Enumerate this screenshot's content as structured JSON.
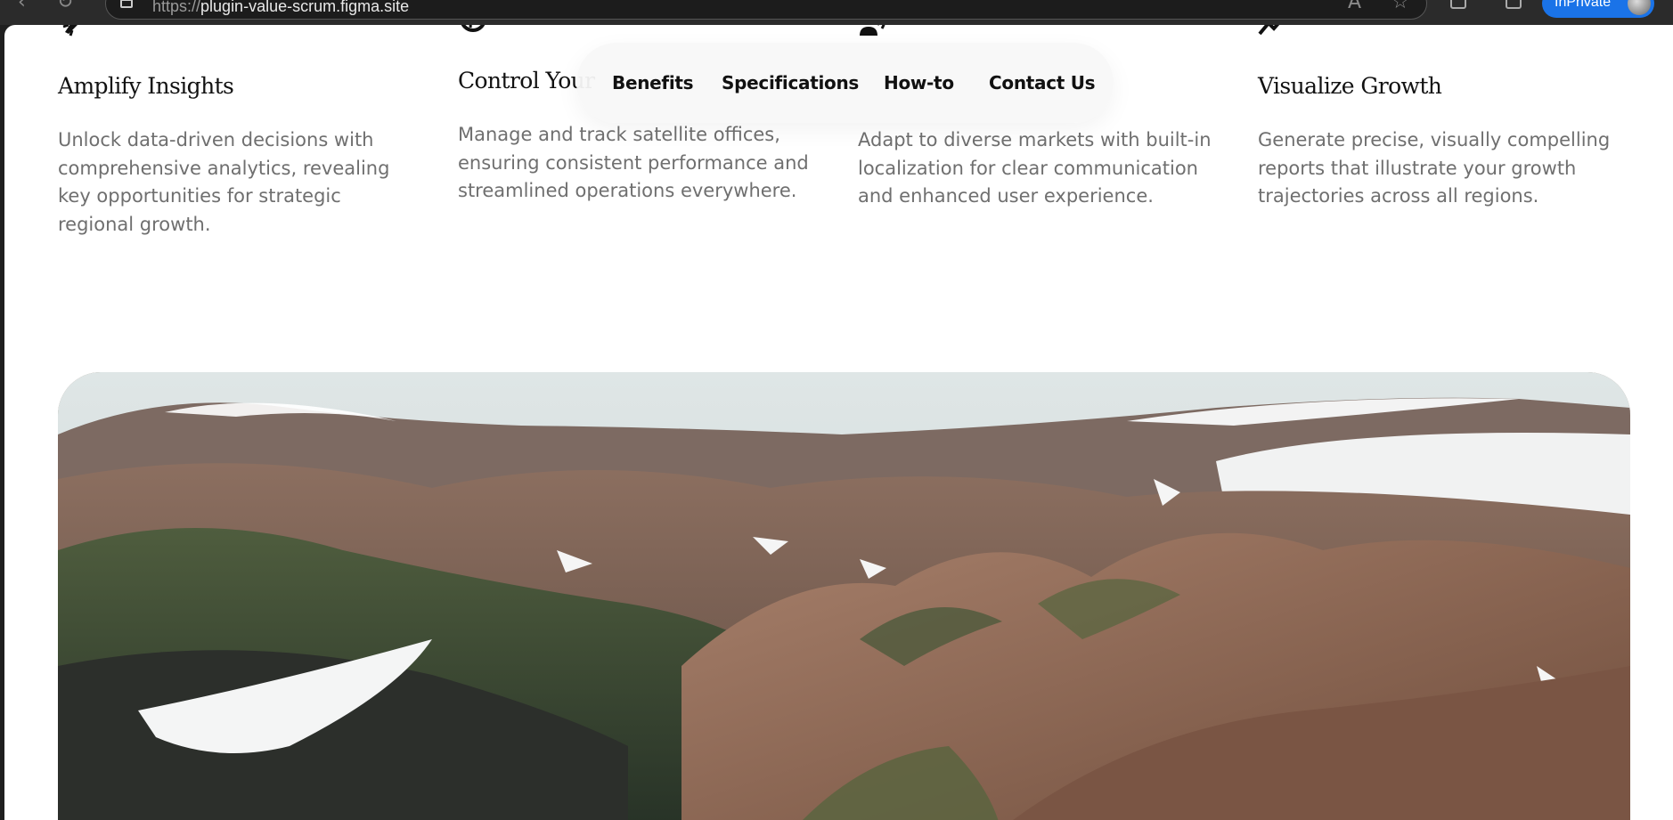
{
  "browser": {
    "url_prefix": "https://",
    "url_host": "plugin-value-scrum.figma.site",
    "profile_label": "InPrivate"
  },
  "nav": {
    "items": [
      "Benefits",
      "Specifications",
      "How-to",
      "Contact Us"
    ]
  },
  "features": [
    {
      "icon": "rocket-icon",
      "title": "Amplify Insights",
      "description": "Unlock data-driven decisions with comprehensive analytics, revealing key opportunities for strategic regional growth."
    },
    {
      "icon": "globe-icon",
      "title": "Control Your",
      "description": "Manage and track satellite offices, ensuring consistent performance and streamlined operations everywhere."
    },
    {
      "icon": "speaking-person-icon",
      "title": "",
      "description": "Adapt to diverse markets with built-in localization for clear communication and enhanced user experience."
    },
    {
      "icon": "trend-up-icon",
      "title": "Visualize Growth",
      "description": "Generate precise, visually compelling reports that illustrate your growth trajectories across all regions."
    }
  ],
  "colors": {
    "page_bg": "#ffffff",
    "title": "#111111",
    "body_text": "#6f6f6f",
    "nav_bg": "#f8f8f8",
    "accent_blue": "#1a73e8"
  }
}
